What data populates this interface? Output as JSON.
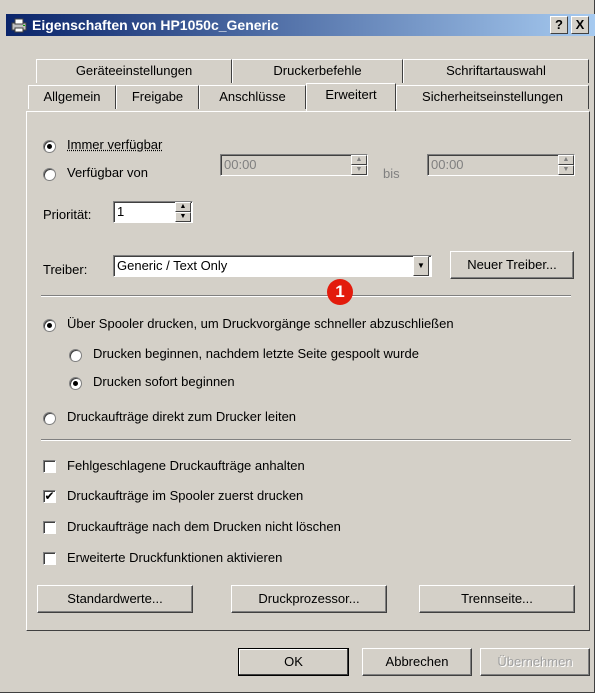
{
  "window": {
    "title": "Eigenschaften von HP1050c_Generic",
    "help_label": "?",
    "close_label": "X"
  },
  "tabs": {
    "row1": [
      "Geräteeinstellungen",
      "Druckerbefehle",
      "Schriftartauswahl"
    ],
    "row2": [
      "Allgemein",
      "Freigabe",
      "Anschlüsse",
      "Erweitert",
      "Sicherheitseinstellungen"
    ],
    "active": "Erweitert"
  },
  "availability": {
    "always_label": "Immer verfügbar",
    "always_checked": true,
    "from_label": "Verfügbar von",
    "from_checked": false,
    "from_time": "00:00",
    "to_label": "bis",
    "to_time": "00:00"
  },
  "priority": {
    "label": "Priorität:",
    "value": "1"
  },
  "driver": {
    "label": "Treiber:",
    "selected": "Generic / Text Only",
    "new_driver_label": "Neuer Treiber..."
  },
  "spooler": {
    "use_spooler_label": "Über Spooler drucken, um Druckvorgänge schneller abzuschließen",
    "use_spooler_checked": true,
    "after_last_page_label": "Drucken beginnen, nachdem letzte Seite gespoolt wurde",
    "after_last_page_checked": false,
    "immediately_label": "Drucken sofort beginnen",
    "immediately_checked": true,
    "direct_label": "Druckaufträge direkt zum Drucker leiten",
    "direct_checked": false
  },
  "options": [
    {
      "label": "Fehlgeschlagene Druckaufträge anhalten",
      "checked": false
    },
    {
      "label": "Druckaufträge im Spooler zuerst drucken",
      "checked": true
    },
    {
      "label": "Druckaufträge nach dem Drucken nicht löschen",
      "checked": false
    },
    {
      "label": "Erweiterte Druckfunktionen aktivieren",
      "checked": false
    }
  ],
  "buttons": {
    "defaults": "Standardwerte...",
    "processor": "Druckprozessor...",
    "separator_page": "Trennseite...",
    "ok": "OK",
    "cancel": "Abbrechen",
    "apply": "Übernehmen"
  },
  "annotation": {
    "marker": "1",
    "color": "#e31b0c"
  },
  "colors": {
    "titlebar_start": "#0a246a",
    "titlebar_end": "#a6caf0",
    "face": "#d4d0c8"
  }
}
